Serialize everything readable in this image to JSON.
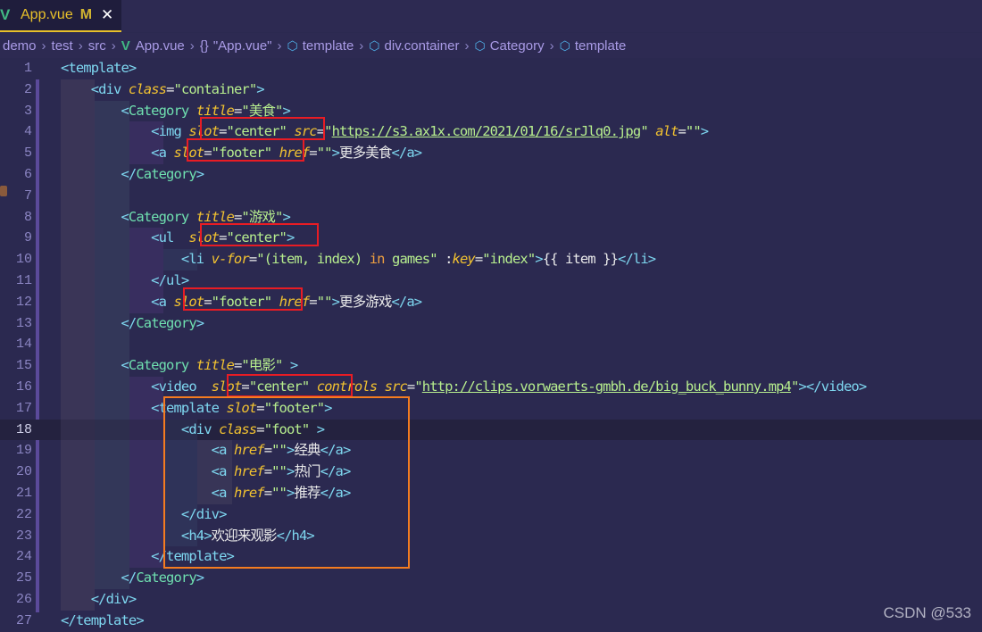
{
  "tab": {
    "file_name": "App.vue",
    "status": "M",
    "close_icon": "close-icon",
    "file_icon": "vue-icon"
  },
  "breadcrumbs": [
    {
      "label": "demo",
      "icon": ""
    },
    {
      "label": "test",
      "icon": ""
    },
    {
      "label": "src",
      "icon": ""
    },
    {
      "label": "App.vue",
      "icon": "vue-icon"
    },
    {
      "label": "\"App.vue\"",
      "icon": "braces-icon"
    },
    {
      "label": "template",
      "icon": "cube-icon"
    },
    {
      "label": "div.container",
      "icon": "cube-icon"
    },
    {
      "label": "Category",
      "icon": "cube-icon"
    },
    {
      "label": "template",
      "icon": "cube-icon"
    }
  ],
  "editor": {
    "active_line": 18,
    "line_numbers": [
      "1",
      "2",
      "3",
      "4",
      "5",
      "6",
      "7",
      "8",
      "9",
      "10",
      "11",
      "12",
      "13",
      "14",
      "15",
      "16",
      "17",
      "18",
      "19",
      "20",
      "21",
      "22",
      "23",
      "24",
      "25",
      "26",
      "27"
    ],
    "lines": [
      [
        [
          "t",
          "<"
        ],
        [
          "tg",
          "template"
        ],
        [
          "t",
          ">"
        ]
      ],
      [
        [
          "t",
          "    <"
        ],
        [
          "tg",
          "div "
        ],
        [
          "at",
          "class"
        ],
        [
          "tx",
          "="
        ],
        [
          "st",
          "\"container\""
        ],
        [
          "t",
          ">"
        ]
      ],
      [
        [
          "t",
          "        <"
        ],
        [
          "cmp",
          "Category "
        ],
        [
          "at",
          "title"
        ],
        [
          "tx",
          "="
        ],
        [
          "st",
          "\"美食\""
        ],
        [
          "t",
          ">"
        ]
      ],
      [
        [
          "t",
          "            <"
        ],
        [
          "tg",
          "img "
        ],
        [
          "at",
          "slot"
        ],
        [
          "tx",
          "="
        ],
        [
          "st",
          "\"center\" "
        ],
        [
          "at",
          "src"
        ],
        [
          "tx",
          "="
        ],
        [
          "st",
          "\""
        ],
        [
          "ur",
          "https://s3.ax1x.com/2021/01/16/srJlq0.jpg"
        ],
        [
          "st",
          "\" "
        ],
        [
          "at",
          "alt"
        ],
        [
          "tx",
          "="
        ],
        [
          "st",
          "\"\""
        ],
        [
          "t",
          ">"
        ]
      ],
      [
        [
          "t",
          "            <"
        ],
        [
          "tg",
          "a "
        ],
        [
          "at",
          "slot"
        ],
        [
          "tx",
          "="
        ],
        [
          "st",
          "\"footer\" "
        ],
        [
          "at",
          "href"
        ],
        [
          "tx",
          "="
        ],
        [
          "st",
          "\"\""
        ],
        [
          "t",
          ">"
        ],
        [
          "tx",
          "更多美食"
        ],
        [
          "t",
          "</"
        ],
        [
          "tg",
          "a"
        ],
        [
          "t",
          ">"
        ]
      ],
      [
        [
          "t",
          "        </"
        ],
        [
          "cmp",
          "Category"
        ],
        [
          "t",
          ">"
        ]
      ],
      [],
      [
        [
          "t",
          "        <"
        ],
        [
          "cmp",
          "Category "
        ],
        [
          "at",
          "title"
        ],
        [
          "tx",
          "="
        ],
        [
          "st",
          "\"游戏\""
        ],
        [
          "t",
          ">"
        ]
      ],
      [
        [
          "t",
          "            <"
        ],
        [
          "tg",
          "ul  "
        ],
        [
          "at",
          "slot"
        ],
        [
          "tx",
          "="
        ],
        [
          "st",
          "\"center\""
        ],
        [
          "t",
          ">"
        ]
      ],
      [
        [
          "t",
          "                <"
        ],
        [
          "tg",
          "li "
        ],
        [
          "at",
          "v-for"
        ],
        [
          "tx",
          "="
        ],
        [
          "st",
          "\"(item, index) "
        ],
        [
          "kw",
          "in"
        ],
        [
          "st",
          " games\" "
        ],
        [
          "tx",
          ":"
        ],
        [
          "at",
          "key"
        ],
        [
          "tx",
          "="
        ],
        [
          "st",
          "\"index\""
        ],
        [
          "t",
          ">"
        ],
        [
          "tx",
          "{{ item }}"
        ],
        [
          "t",
          "</"
        ],
        [
          "tg",
          "li"
        ],
        [
          "t",
          ">"
        ]
      ],
      [
        [
          "t",
          "            </"
        ],
        [
          "tg",
          "ul"
        ],
        [
          "t",
          ">"
        ]
      ],
      [
        [
          "t",
          "            <"
        ],
        [
          "tg",
          "a "
        ],
        [
          "at",
          "slot"
        ],
        [
          "tx",
          "="
        ],
        [
          "st",
          "\"footer\" "
        ],
        [
          "at",
          "href"
        ],
        [
          "tx",
          "="
        ],
        [
          "st",
          "\"\""
        ],
        [
          "t",
          ">"
        ],
        [
          "tx",
          "更多游戏"
        ],
        [
          "t",
          "</"
        ],
        [
          "tg",
          "a"
        ],
        [
          "t",
          ">"
        ]
      ],
      [
        [
          "t",
          "        </"
        ],
        [
          "cmp",
          "Category"
        ],
        [
          "t",
          ">"
        ]
      ],
      [],
      [
        [
          "t",
          "        <"
        ],
        [
          "cmp",
          "Category "
        ],
        [
          "at",
          "title"
        ],
        [
          "tx",
          "="
        ],
        [
          "st",
          "\"电影\" "
        ],
        [
          "t",
          ">"
        ]
      ],
      [
        [
          "t",
          "            <"
        ],
        [
          "tg",
          "video  "
        ],
        [
          "at",
          "slot"
        ],
        [
          "tx",
          "="
        ],
        [
          "st",
          "\"center\" "
        ],
        [
          "at",
          "controls "
        ],
        [
          "at",
          "src"
        ],
        [
          "tx",
          "="
        ],
        [
          "st",
          "\""
        ],
        [
          "ur",
          "http://clips.vorwaerts-gmbh.de/big_buck_bunny.mp4"
        ],
        [
          "st",
          "\""
        ],
        [
          "t",
          "></"
        ],
        [
          "tg",
          "video"
        ],
        [
          "t",
          ">"
        ]
      ],
      [
        [
          "t",
          "            <"
        ],
        [
          "tg",
          "template "
        ],
        [
          "at",
          "slot"
        ],
        [
          "tx",
          "="
        ],
        [
          "st",
          "\"footer\""
        ],
        [
          "t",
          ">"
        ]
      ],
      [
        [
          "t",
          "                <"
        ],
        [
          "tg",
          "div "
        ],
        [
          "at",
          "class"
        ],
        [
          "tx",
          "="
        ],
        [
          "st",
          "\"foot\" "
        ],
        [
          "t",
          ">"
        ]
      ],
      [
        [
          "t",
          "                    <"
        ],
        [
          "tg",
          "a "
        ],
        [
          "at",
          "href"
        ],
        [
          "tx",
          "="
        ],
        [
          "st",
          "\"\""
        ],
        [
          "t",
          ">"
        ],
        [
          "tx",
          "经典"
        ],
        [
          "t",
          "</"
        ],
        [
          "tg",
          "a"
        ],
        [
          "t",
          ">"
        ]
      ],
      [
        [
          "t",
          "                    <"
        ],
        [
          "tg",
          "a "
        ],
        [
          "at",
          "href"
        ],
        [
          "tx",
          "="
        ],
        [
          "st",
          "\"\""
        ],
        [
          "t",
          ">"
        ],
        [
          "tx",
          "热门"
        ],
        [
          "t",
          "</"
        ],
        [
          "tg",
          "a"
        ],
        [
          "t",
          ">"
        ]
      ],
      [
        [
          "t",
          "                    <"
        ],
        [
          "tg",
          "a "
        ],
        [
          "at",
          "href"
        ],
        [
          "tx",
          "="
        ],
        [
          "st",
          "\"\""
        ],
        [
          "t",
          ">"
        ],
        [
          "tx",
          "推荐"
        ],
        [
          "t",
          "</"
        ],
        [
          "tg",
          "a"
        ],
        [
          "t",
          ">"
        ]
      ],
      [
        [
          "t",
          "                </"
        ],
        [
          "tg",
          "div"
        ],
        [
          "t",
          ">"
        ]
      ],
      [
        [
          "t",
          "                <"
        ],
        [
          "tg",
          "h4"
        ],
        [
          "t",
          ">"
        ],
        [
          "tx",
          "欢迎来观影"
        ],
        [
          "t",
          "</"
        ],
        [
          "tg",
          "h4"
        ],
        [
          "t",
          ">"
        ]
      ],
      [
        [
          "t",
          "            </"
        ],
        [
          "tg",
          "template"
        ],
        [
          "t",
          ">"
        ]
      ],
      [
        [
          "t",
          "        </"
        ],
        [
          "cmp",
          "Category"
        ],
        [
          "t",
          ">"
        ]
      ],
      [
        [
          "t",
          "    </"
        ],
        [
          "tg",
          "div"
        ],
        [
          "t",
          ">"
        ]
      ],
      [
        [
          "t",
          "</"
        ],
        [
          "tg",
          "template"
        ],
        [
          "t",
          ">"
        ]
      ]
    ]
  },
  "colors": {
    "background": "#2b2950",
    "highlight_slot": "#e81c24",
    "highlight_template": "#f47c20",
    "tab_accent": "#e8c02a",
    "vue_green": "#41b883"
  },
  "watermark": "CSDN @533"
}
